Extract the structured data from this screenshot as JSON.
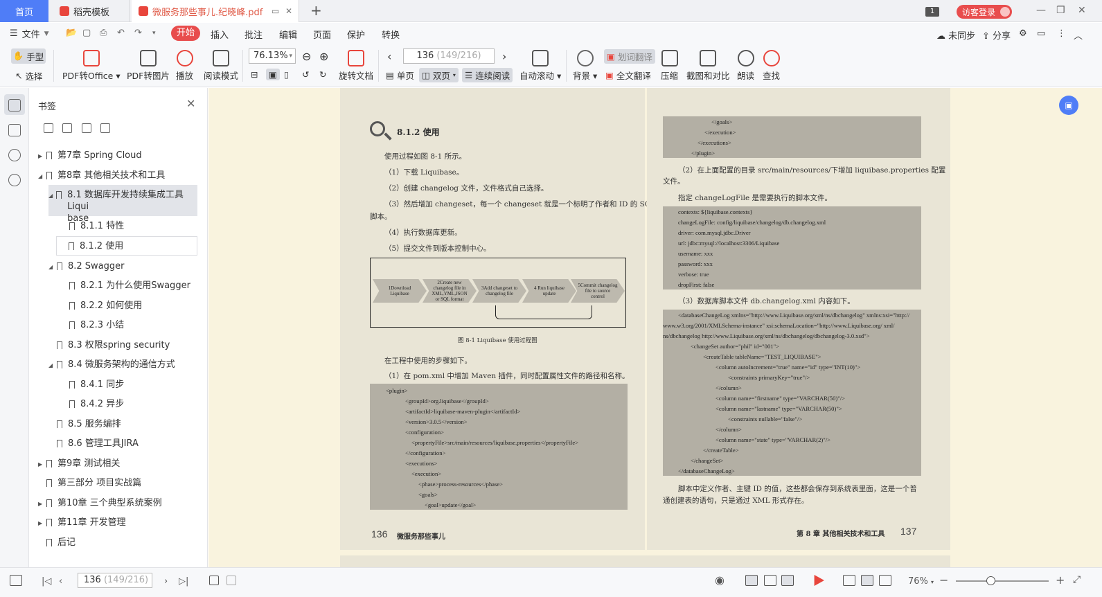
{
  "tabs": {
    "home": "首页",
    "template": "稻壳模板",
    "document": "微服务那些事儿.纪晓峰.pdf",
    "count_badge": "1",
    "login": "访客登录"
  },
  "menu": {
    "file": "文件",
    "items": [
      "开始",
      "插入",
      "批注",
      "编辑",
      "页面",
      "保护",
      "转换"
    ],
    "sync": "未同步",
    "share": "分享"
  },
  "toolbar": {
    "hand": "手型",
    "select": "选择",
    "pdf_to_office": "PDF转Office",
    "pdf_to_image": "PDF转图片",
    "play": "播放",
    "read_mode": "阅读模式",
    "zoom": "76.13%",
    "page_current": "136",
    "page_total": "(149/216)",
    "rotate": "旋转文档",
    "single": "单页",
    "double": "双页",
    "continuous": "连续阅读",
    "auto_scroll": "自动滚动",
    "background": "背景",
    "word_translate": "划词翻译",
    "full_translate": "全文翻译",
    "compress": "压缩",
    "capture_compare": "截图和对比",
    "read_aloud": "朗读",
    "find": "查找"
  },
  "panel": {
    "title": "书签",
    "items": [
      {
        "label": "第7章 Spring Cloud"
      },
      {
        "label": "第8章 其他相关技术和工具"
      },
      {
        "label": "8.1 数据库开发持续集成工具Liquibase",
        "line1": "8.1 数据库开发持续集成工具Liqui",
        "line2": "base"
      },
      {
        "label": "8.1.1 特性"
      },
      {
        "label": "8.1.2 使用"
      },
      {
        "label": "8.2 Swagger"
      },
      {
        "label": "8.2.1 为什么使用Swagger"
      },
      {
        "label": "8.2.2 如何使用"
      },
      {
        "label": "8.2.3 小结"
      },
      {
        "label": "8.3 权限spring security"
      },
      {
        "label": "8.4 微服务架构的通信方式"
      },
      {
        "label": "8.4.1 同步"
      },
      {
        "label": "8.4.2 异步"
      },
      {
        "label": "8.5 服务编排"
      },
      {
        "label": "8.6 管理工具JIRA"
      },
      {
        "label": "第9章 测试相关"
      },
      {
        "label": "第三部分 项目实战篇"
      },
      {
        "label": "第10章 三个典型系统案例"
      },
      {
        "label": "第11章 开发管理"
      },
      {
        "label": "后记"
      }
    ]
  },
  "left_page": {
    "heading": "8.1.2  使用",
    "lines": [
      "使用过程如图 8-1 所示。",
      "（1）下载 Liquibase。",
      "（2）创建 changelog 文件，文件格式自己选择。",
      "（3）然后增加 changeset，每一个 changeset 就是一个标明了作者和 ID 的 SQL",
      "脚本。",
      "（4）执行数据库更新。",
      "（5）提交文件到版本控制中心。"
    ],
    "flow_steps": [
      "1Download Liquibase",
      "2Create new changelog file in XML,YML,JSON or SQL format",
      "3Add changeset to changelog file",
      "4 Run liquibase update",
      "5Commit changelog file to source control"
    ],
    "figure_caption": "图 8-1   Liquibase 使用过程图",
    "after_lines": [
      "在工程中使用的步骤如下。",
      "（1）在 pom.xml 中增加 Maven 插件，同时配置属性文件的路径和名称。"
    ],
    "code": [
      "<plugin>",
      "<groupId>org.liquibase</groupId>",
      "<artifactId>liquibase-maven-plugin</artifactId>",
      "<version>3.0.5</version>",
      "<configuration>",
      "<propertyFile>src/main/resources/liquibase.properties</propertyFile>",
      "</configuration>",
      "<executions>",
      "<execution>",
      "<phase>process-resources</phase>",
      "<goals>",
      "<goal>update</goal>"
    ],
    "page_number": "136",
    "footer": "微服务那些事儿"
  },
  "right_page": {
    "code_top": [
      "</goals>",
      "</execution>",
      "</executions>",
      "</plugin>"
    ],
    "para1": [
      "（2）在上面配置的目录 src/main/resources/下增加 liquibase.properties 配置",
      "文件。"
    ],
    "para2": "指定 changeLogFile 是需要执行的脚本文件。",
    "props": [
      "contexts: ${liquibase.contexts}",
      "changeLogFile: config/liquibase/changelog/db.changelog.xml",
      "driver: com.mysql.jdbc.Driver",
      "url: jdbc:mysql://localhost:3306/Liquibase",
      "username: xxx",
      "password: xxx",
      "verbose: true",
      "dropFirst: false"
    ],
    "para3": "（3）数据库脚本文件 db.changelog.xml 内容如下。",
    "xml": [
      "<databaseChangeLog    xmlns=\"http://www.Liquibase.org/xml/ns/dbchangelog\"    xmlns:xsi=\"http://",
      "www.w3.org/2001/XMLSchema-instance\"   xsi:schemaLocation=\"http://www.Liquibase.org/   xml/",
      "ns/dbchangelog http://www.Liquibase.org/xml/ns/dbchangelog/dbchangelog-3.0.xsd\">",
      "<changeSet author=\"phil\" id=\"001\">",
      "<createTable tableName=\"TEST_LIQUIBASE\">",
      "<column autoIncrement=\"true\" name=\"id\" type=\"INT(10)\">",
      "<constraints primaryKey=\"true\"/>",
      "</column>",
      "<column name=\"firstname\" type=\"VARCHAR(50)\"/>",
      "<column name=\"lastname\" type=\"VARCHAR(50)\">",
      "<constraints nullable=\"false\"/>",
      "</column>",
      "<column name=\"state\" type=\"VARCHAR(2)\"/>",
      "</createTable>",
      "</changeSet>",
      "</databaseChangeLog>"
    ],
    "para4": [
      "脚本中定义作者、主键 ID 的值，这些都会保存到系统表里面，这是一个普",
      "通创建表的语句，只是通过 XML 形式存在。"
    ],
    "footer": "第 8 章   其他相关技术和工具",
    "page_number": "137"
  },
  "status": {
    "page_current": "136",
    "page_total": "(149/216)",
    "zoom": "76%"
  },
  "colors": {
    "accent": "#4f7df7",
    "brand_red": "#e84d4d",
    "page_bg": "#f9f3de"
  }
}
